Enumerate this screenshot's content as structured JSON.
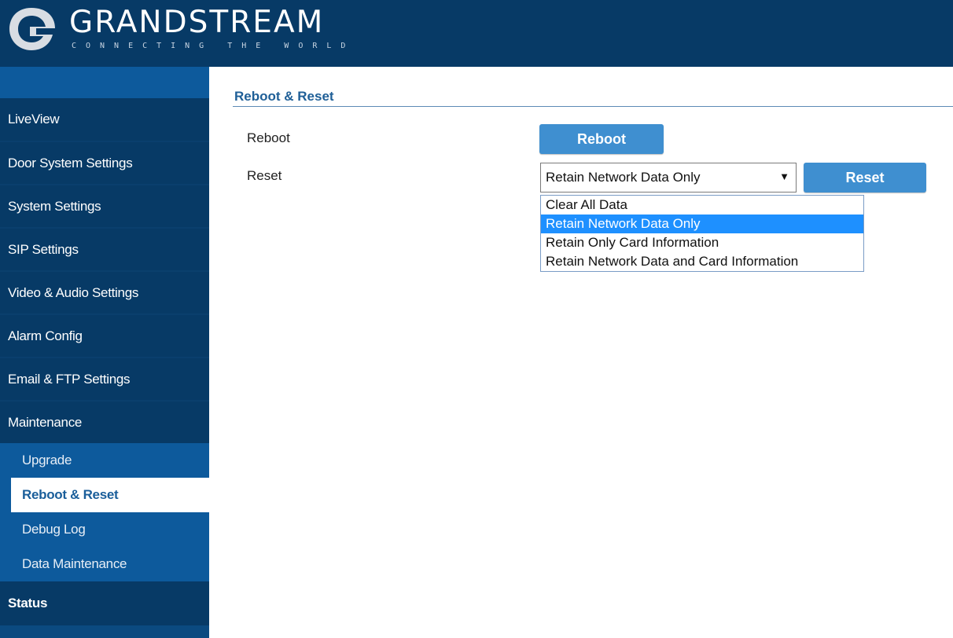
{
  "header": {
    "brand": "GRANDSTREAM",
    "tagline": "CONNECTING THE WORLD",
    "logo_icon": "grandstream-logo-icon"
  },
  "sidebar": {
    "items": [
      {
        "label": "LiveView"
      },
      {
        "label": "Door System Settings"
      },
      {
        "label": "System Settings"
      },
      {
        "label": "SIP Settings"
      },
      {
        "label": "Video & Audio Settings"
      },
      {
        "label": "Alarm Config"
      },
      {
        "label": "Email & FTP Settings"
      },
      {
        "label": "Maintenance"
      }
    ],
    "subitems": [
      {
        "label": "Upgrade"
      },
      {
        "label": "Reboot & Reset",
        "active": true
      },
      {
        "label": "Debug Log"
      },
      {
        "label": "Data Maintenance"
      }
    ],
    "status": "Status"
  },
  "main": {
    "title": "Reboot & Reset",
    "reboot_label": "Reboot",
    "reboot_button": "Reboot",
    "reset_label": "Reset",
    "reset_button": "Reset",
    "reset_select_value": "Retain Network Data Only",
    "reset_options": [
      "Clear All Data",
      "Retain Network Data Only",
      "Retain Only Card Information",
      "Retain Network Data and Card Information"
    ],
    "selected_option_index": 1
  },
  "colors": {
    "header_bg": "#073a66",
    "sidebar_sub_bg": "#0d5a9c",
    "button_bg": "#3f8fd0",
    "dropdown_highlight": "#1e90ff",
    "title_color": "#1f5f97"
  }
}
